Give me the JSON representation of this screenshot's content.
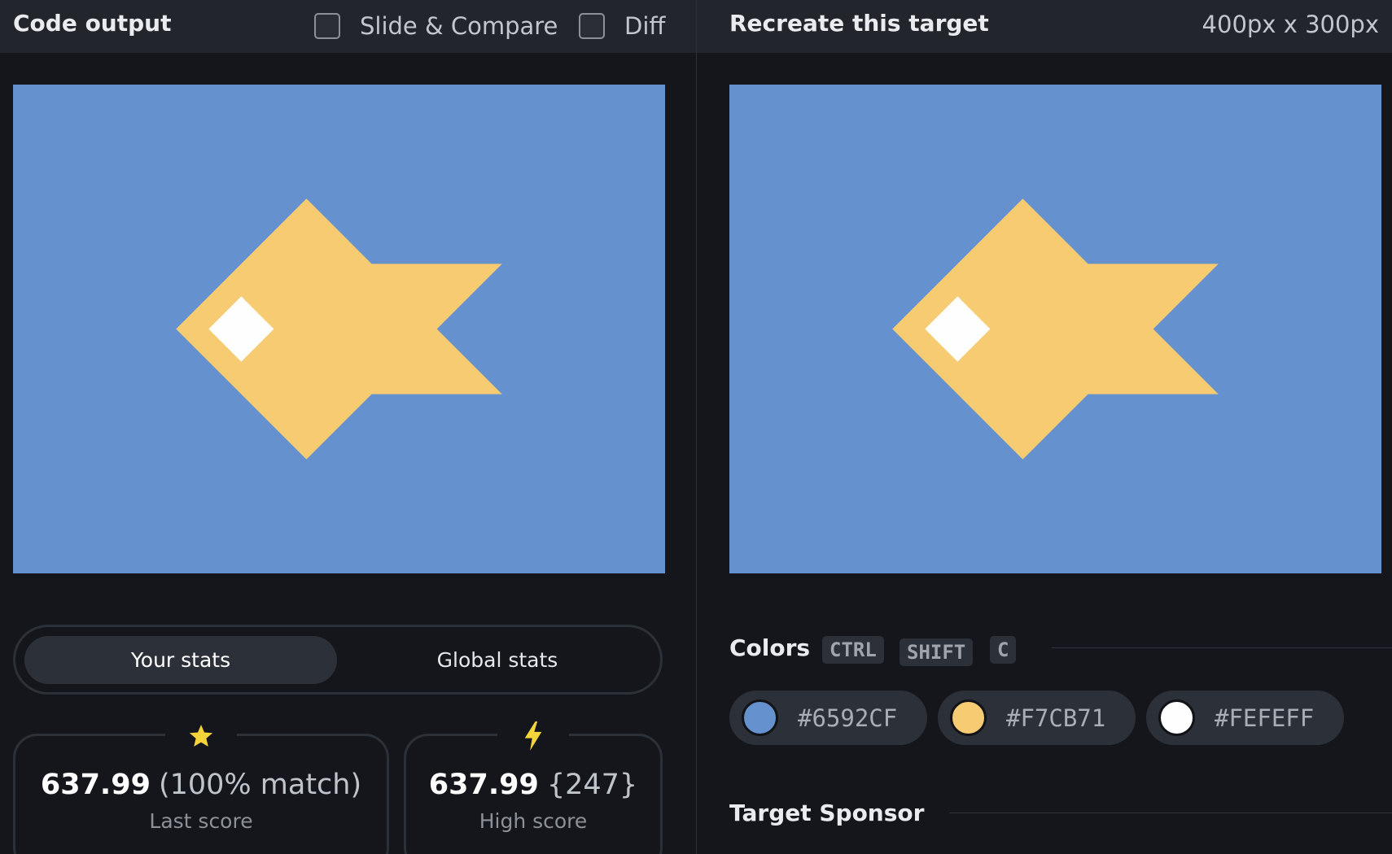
{
  "left_panel": {
    "title": "Code output",
    "slide_compare_label": "Slide & Compare",
    "diff_label": "Diff",
    "slide_compare_checked": false,
    "diff_checked": false
  },
  "right_panel": {
    "title": "Recreate this target",
    "dimensions": "400px x 300px"
  },
  "canvas_colors": {
    "background": "#6592CF",
    "fish": "#F7CB71",
    "eye": "#FEFEFF"
  },
  "stats": {
    "tabs": [
      "Your stats",
      "Global stats"
    ],
    "active_tab": "Your stats",
    "last": {
      "icon": "star-icon",
      "value": "637.99",
      "extra": "(100% match)",
      "label": "Last score"
    },
    "high": {
      "icon": "lightning-icon",
      "value": "637.99",
      "extra": "{247}",
      "label": "High score"
    }
  },
  "colors_section": {
    "heading": "Colors",
    "shortcut_keys": [
      "CTRL",
      "SHIFT",
      "C"
    ],
    "swatches": [
      {
        "hex": "#6592CF",
        "color": "#6592CF"
      },
      {
        "hex": "#F7CB71",
        "color": "#F7CB71"
      },
      {
        "hex": "#FEFEFF",
        "color": "#FEFEFF"
      }
    ]
  },
  "sponsor_section": {
    "heading": "Target Sponsor"
  }
}
